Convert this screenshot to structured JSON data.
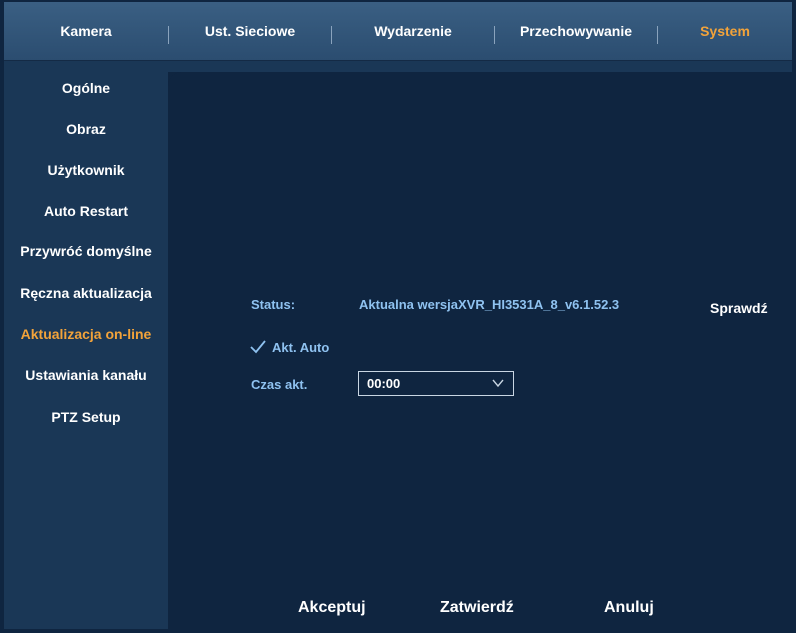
{
  "tabs": [
    {
      "label": "Kamera",
      "active": false
    },
    {
      "label": "Ust. Sieciowe",
      "active": false
    },
    {
      "label": "Wydarzenie",
      "active": false
    },
    {
      "label": "Przechowywanie",
      "active": false
    },
    {
      "label": "System",
      "active": true
    }
  ],
  "sidebar": {
    "items": [
      {
        "label": "Ogólne"
      },
      {
        "label": "Obraz"
      },
      {
        "label": "Użytkownik"
      },
      {
        "label": "Auto Restart"
      },
      {
        "label": "Przywróć domyślne"
      },
      {
        "label": "Ręczna aktualizacja"
      },
      {
        "label": "Aktualizacja on-line"
      },
      {
        "label": "Ustawiania kanału"
      },
      {
        "label": "PTZ Setup"
      }
    ],
    "active_index": 6
  },
  "update": {
    "status_label": "Status:",
    "status_value": "Aktualna wersjaXVR_HI3531A_8_v6.1.52.3",
    "check_button": "Sprawdź",
    "auto_update_label": "Akt. Auto",
    "auto_update_checked": true,
    "time_label": "Czas akt.",
    "time_value": "00:00"
  },
  "footer": {
    "accept": "Akceptuj",
    "confirm": "Zatwierdź",
    "cancel": "Anuluj"
  },
  "colors": {
    "active": "#f2a33a",
    "accent_blue": "#8fc2f0",
    "background": "#0f2540",
    "sidebar": "#1a3756"
  }
}
